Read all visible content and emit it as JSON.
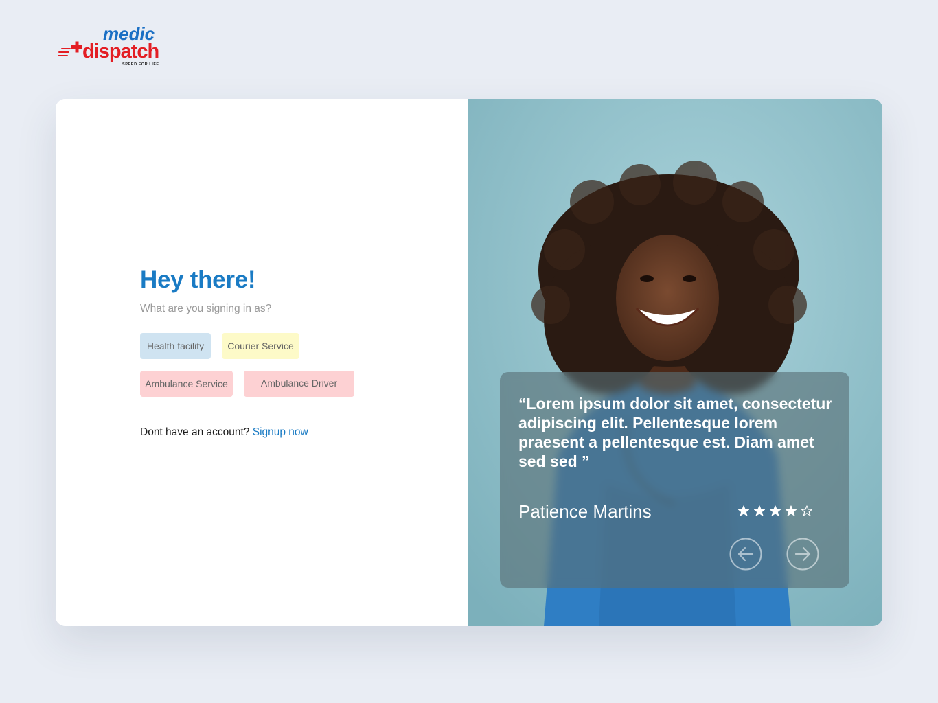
{
  "brand": {
    "name_top": "medic",
    "name_bottom": "dispatch",
    "tagline": "SPEED FOR LIFE",
    "colors": {
      "blue": "#1a6fc4",
      "red": "#e31e24"
    }
  },
  "login": {
    "greeting": "Hey there!",
    "subtitle": "What are you signing in as?",
    "roles": [
      {
        "label": "Health facility",
        "color": "#cfe3f1"
      },
      {
        "label": "Courier Service",
        "color": "#fdfac8"
      },
      {
        "label": "Ambulance Service",
        "color": "#fdd1d3"
      },
      {
        "label": "Ambulance Driver",
        "color": "#fdd1d3"
      }
    ],
    "signup_prompt": "Dont have an account?",
    "signup_link": "Signup now"
  },
  "testimonial": {
    "quote": "“Lorem ipsum dolor sit amet, consectetur adipiscing elit. Pellentesque lorem praesent a pellentesque est. Diam amet sed sed ”",
    "author": "Patience Martins",
    "rating": 4,
    "rating_max": 5,
    "prev_icon": "arrow-left-circle-icon",
    "next_icon": "arrow-right-circle-icon"
  },
  "colors": {
    "accent": "#1a7bc4",
    "page_bg": "#e9edf4",
    "photo_bg": "#92c0ca"
  }
}
